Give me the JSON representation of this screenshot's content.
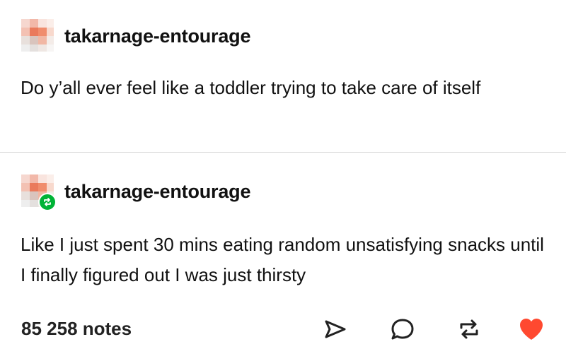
{
  "posts": [
    {
      "username": "takarnage-entourage",
      "text": "Do y’all ever feel like a toddler trying to take care of itself"
    },
    {
      "username": "takarnage-entourage",
      "text": "Like I just spent 30 mins eating random unsatisfying snacks until I finally figured out I was just thirsty",
      "reblog_badge_icon": "reblog-icon"
    }
  ],
  "footer": {
    "notes": "85 258 notes",
    "actions": [
      {
        "icon": "share-icon"
      },
      {
        "icon": "reply-icon"
      },
      {
        "icon": "reblog-icon"
      },
      {
        "icon": "heart-icon",
        "liked": true
      }
    ]
  },
  "colors": {
    "like_red": "#ff4930",
    "reblog_green": "#00b336",
    "divider": "#d6d6d6"
  }
}
